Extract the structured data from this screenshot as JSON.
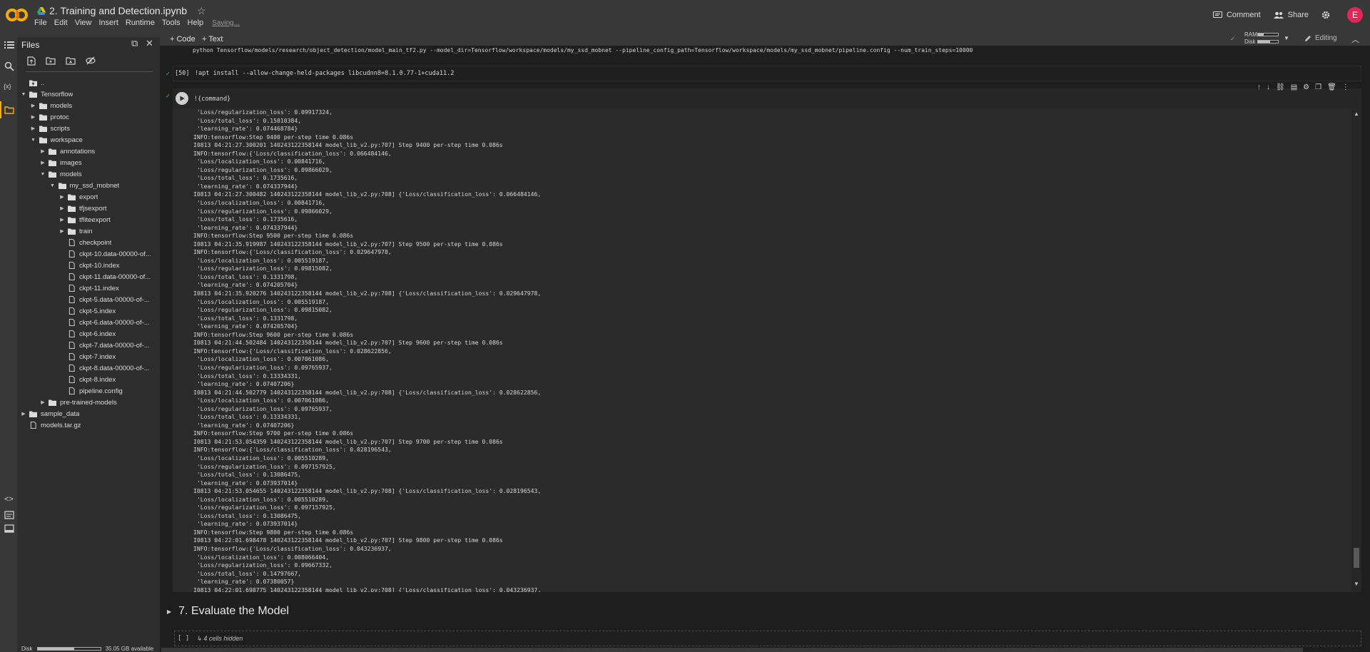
{
  "header": {
    "logo": "colab-logo",
    "title": "2. Training and Detection.ipynb",
    "menu": [
      "File",
      "Edit",
      "View",
      "Insert",
      "Runtime",
      "Tools",
      "Help"
    ],
    "saving": "Saving...",
    "comment_label": "Comment",
    "share_label": "Share",
    "avatar_letter": "E",
    "avatar_color": "#e3265a"
  },
  "toolbar": {
    "code_label": "+ Code",
    "text_label": "+ Text",
    "ram_label": "RAM",
    "disk_label": "Disk",
    "ram_usage": 0.3,
    "disk_usage": 0.6,
    "editing_label": "Editing"
  },
  "files_panel": {
    "title": "Files",
    "tree": [
      {
        "label": "..",
        "kind": "folder-up",
        "depth": 0,
        "arrow": ""
      },
      {
        "label": "Tensorflow",
        "kind": "folder",
        "depth": 0,
        "arrow": "open"
      },
      {
        "label": "models",
        "kind": "folder",
        "depth": 1,
        "arrow": "closed"
      },
      {
        "label": "protoc",
        "kind": "folder",
        "depth": 1,
        "arrow": "closed"
      },
      {
        "label": "scripts",
        "kind": "folder",
        "depth": 1,
        "arrow": "closed"
      },
      {
        "label": "workspace",
        "kind": "folder",
        "depth": 1,
        "arrow": "open"
      },
      {
        "label": "annotations",
        "kind": "folder",
        "depth": 2,
        "arrow": "closed"
      },
      {
        "label": "images",
        "kind": "folder",
        "depth": 2,
        "arrow": "closed"
      },
      {
        "label": "models",
        "kind": "folder",
        "depth": 2,
        "arrow": "open"
      },
      {
        "label": "my_ssd_mobnet",
        "kind": "folder",
        "depth": 3,
        "arrow": "open"
      },
      {
        "label": "export",
        "kind": "folder",
        "depth": 4,
        "arrow": "closed"
      },
      {
        "label": "tfjsexport",
        "kind": "folder",
        "depth": 4,
        "arrow": "closed"
      },
      {
        "label": "tfliteexport",
        "kind": "folder",
        "depth": 4,
        "arrow": "closed"
      },
      {
        "label": "train",
        "kind": "folder",
        "depth": 4,
        "arrow": "closed"
      },
      {
        "label": "checkpoint",
        "kind": "file",
        "depth": 4,
        "arrow": ""
      },
      {
        "label": "ckpt-10.data-00000-of...",
        "kind": "file",
        "depth": 4,
        "arrow": ""
      },
      {
        "label": "ckpt-10.index",
        "kind": "file",
        "depth": 4,
        "arrow": ""
      },
      {
        "label": "ckpt-11.data-00000-of...",
        "kind": "file",
        "depth": 4,
        "arrow": ""
      },
      {
        "label": "ckpt-11.index",
        "kind": "file",
        "depth": 4,
        "arrow": ""
      },
      {
        "label": "ckpt-5.data-00000-of-...",
        "kind": "file",
        "depth": 4,
        "arrow": ""
      },
      {
        "label": "ckpt-5.index",
        "kind": "file",
        "depth": 4,
        "arrow": ""
      },
      {
        "label": "ckpt-6.data-00000-of-...",
        "kind": "file",
        "depth": 4,
        "arrow": ""
      },
      {
        "label": "ckpt-6.index",
        "kind": "file",
        "depth": 4,
        "arrow": ""
      },
      {
        "label": "ckpt-7.data-00000-of-...",
        "kind": "file",
        "depth": 4,
        "arrow": ""
      },
      {
        "label": "ckpt-7.index",
        "kind": "file",
        "depth": 4,
        "arrow": ""
      },
      {
        "label": "ckpt-8.data-00000-of-...",
        "kind": "file",
        "depth": 4,
        "arrow": ""
      },
      {
        "label": "ckpt-8.index",
        "kind": "file",
        "depth": 4,
        "arrow": ""
      },
      {
        "label": "pipeline.config",
        "kind": "file",
        "depth": 4,
        "arrow": ""
      },
      {
        "label": "pre-trained-models",
        "kind": "folder",
        "depth": 2,
        "arrow": "closed"
      },
      {
        "label": "sample_data",
        "kind": "folder",
        "depth": 0,
        "arrow": "closed"
      },
      {
        "label": "models.tar.gz",
        "kind": "file",
        "depth": 0,
        "arrow": ""
      }
    ],
    "disk_label": "Disk",
    "disk_available": "35.05 GB available"
  },
  "notebook": {
    "prev_command": "python Tensorflow/models/research/object_detection/model_main_tf2.py --model_dir=Tensorflow/workspace/models/my_ssd_mobnet --pipeline_config_path=Tensorflow/workspace/models/my_ssd_mobnet/pipeline.config --num_train_steps=10000",
    "apt_cell": {
      "exec_count": "[50]",
      "source": "!apt install --allow-change-held-packages libcudnn8=8.1.0.77-1+cuda11.2"
    },
    "run_cell": {
      "source": "!{command}"
    },
    "output_lines": [
      " 'Loss/regularization_loss': 0.09917324,",
      " 'Loss/total_loss': 0.15810384,",
      " 'learning_rate': 0.074468784}",
      "INFO:tensorflow:Step 9400 per-step time 0.086s",
      "I0813 04:21:27.300201 140243122358144 model_lib_v2.py:707] Step 9400 per-step time 0.086s",
      "INFO:tensorflow:{'Loss/classification_loss': 0.066484146,",
      " 'Loss/localization_loss': 0.00841716,",
      " 'Loss/regularization_loss': 0.09866029,",
      " 'Loss/total_loss': 0.1735616,",
      " 'learning_rate': 0.074337944}",
      "I0813 04:21:27.300482 140243122358144 model_lib_v2.py:708] {'Loss/classification_loss': 0.066484146,",
      " 'Loss/localization_loss': 0.00841716,",
      " 'Loss/regularization_loss': 0.09866029,",
      " 'Loss/total_loss': 0.1735616,",
      " 'learning_rate': 0.074337944}",
      "INFO:tensorflow:Step 9500 per-step time 0.086s",
      "I0813 04:21:35.919987 140243122358144 model_lib_v2.py:707] Step 9500 per-step time 0.086s",
      "INFO:tensorflow:{'Loss/classification_loss': 0.029647978,",
      " 'Loss/localization_loss': 0.005519187,",
      " 'Loss/regularization_loss': 0.09815082,",
      " 'Loss/total_loss': 0.1331798,",
      " 'learning_rate': 0.074205704}",
      "I0813 04:21:35.920276 140243122358144 model_lib_v2.py:708] {'Loss/classification_loss': 0.029647978,",
      " 'Loss/localization_loss': 0.005519187,",
      " 'Loss/regularization_loss': 0.09815082,",
      " 'Loss/total_loss': 0.1331798,",
      " 'learning_rate': 0.074205704}",
      "INFO:tensorflow:Step 9600 per-step time 0.086s",
      "I0813 04:21:44.502484 140243122358144 model_lib_v2.py:707] Step 9600 per-step time 0.086s",
      "INFO:tensorflow:{'Loss/classification_loss': 0.028622856,",
      " 'Loss/localization_loss': 0.007061086,",
      " 'Loss/regularization_loss': 0.09765937,",
      " 'Loss/total_loss': 0.13334331,",
      " 'learning_rate': 0.07407206}",
      "I0813 04:21:44.502779 140243122358144 model_lib_v2.py:708] {'Loss/classification_loss': 0.028622856,",
      " 'Loss/localization_loss': 0.007061086,",
      " 'Loss/regularization_loss': 0.09765937,",
      " 'Loss/total_loss': 0.13334331,",
      " 'learning_rate': 0.07407206}",
      "INFO:tensorflow:Step 9700 per-step time 0.086s",
      "I0813 04:21:53.054359 140243122358144 model_lib_v2.py:707] Step 9700 per-step time 0.086s",
      "INFO:tensorflow:{'Loss/classification_loss': 0.028196543,",
      " 'Loss/localization_loss': 0.005510289,",
      " 'Loss/regularization_loss': 0.097157925,",
      " 'Loss/total_loss': 0.13086475,",
      " 'learning_rate': 0.073937014}",
      "I0813 04:21:53.054655 140243122358144 model_lib_v2.py:708] {'Loss/classification_loss': 0.028196543,",
      " 'Loss/localization_loss': 0.005510289,",
      " 'Loss/regularization_loss': 0.097157925,",
      " 'Loss/total_loss': 0.13086475,",
      " 'learning_rate': 0.073937014}",
      "INFO:tensorflow:Step 9800 per-step time 0.086s",
      "I0813 04:22:01.698478 140243122358144 model_lib_v2.py:707] Step 9800 per-step time 0.086s",
      "INFO:tensorflow:{'Loss/classification_loss': 0.043236937,",
      " 'Loss/localization_loss': 0.008066404,",
      " 'Loss/regularization_loss': 0.09667332,",
      " 'Loss/total_loss': 0.14797667,",
      " 'learning_rate': 0.07380057}",
      "I0813 04:22:01.698775 140243122358144 model_lib_v2.py:708] {'Loss/classification_loss': 0.043236937,"
    ],
    "section_heading": "7. Evaluate the Model",
    "hidden_cells": {
      "brackets": "[ ]",
      "label": "↳ 4 cells hidden"
    }
  }
}
